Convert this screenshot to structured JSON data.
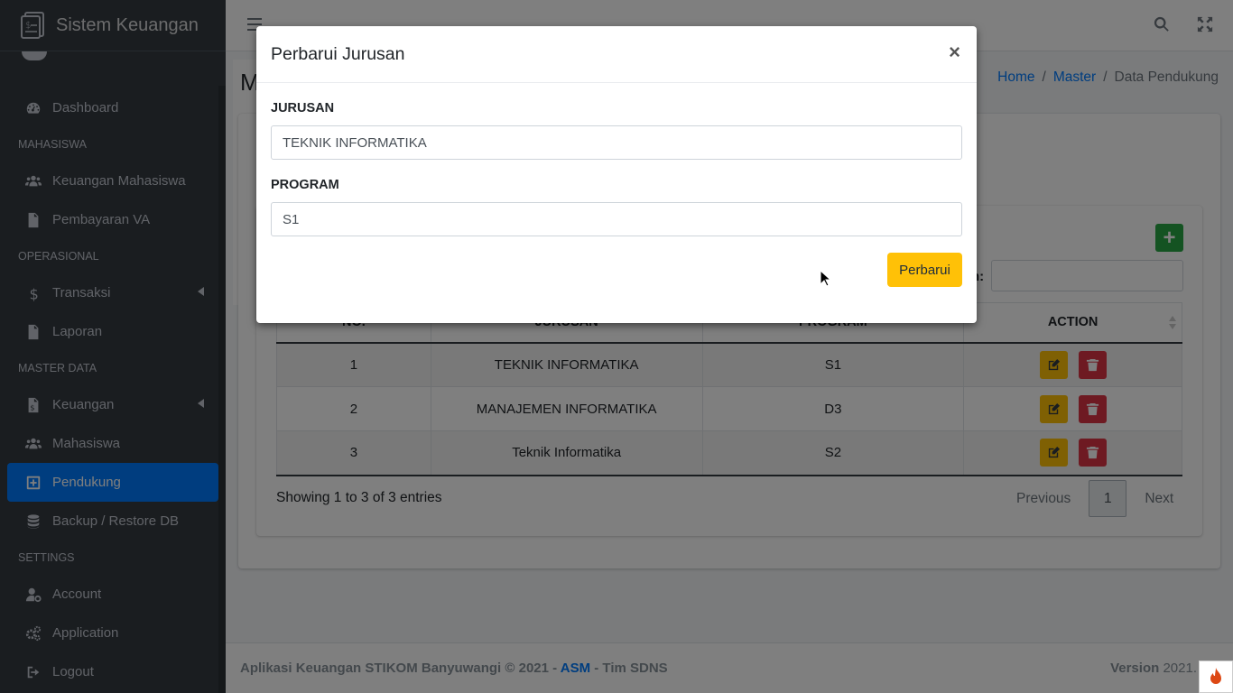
{
  "app": {
    "brand": "Sistem Keuangan"
  },
  "sidebar": {
    "items": [
      {
        "label": "Dashboard",
        "icon": "dashboard-icon"
      },
      {
        "header": "MAHASISWA"
      },
      {
        "label": "Keuangan Mahasiswa",
        "icon": "users-icon"
      },
      {
        "label": "Pembayaran VA",
        "icon": "file-icon"
      },
      {
        "header": "OPERASIONAL"
      },
      {
        "label": "Transaksi",
        "icon": "dollar-icon"
      },
      {
        "label": "Laporan",
        "icon": "file-icon"
      },
      {
        "header": "MASTER DATA"
      },
      {
        "label": "Keuangan",
        "icon": "invoice-icon"
      },
      {
        "label": "Mahasiswa",
        "icon": "users-icon"
      },
      {
        "label": "Pendukung",
        "icon": "plus-square-icon",
        "active": true
      },
      {
        "label": "Backup / Restore DB",
        "icon": "database-icon"
      },
      {
        "header": "SETTINGS"
      },
      {
        "label": "Account",
        "icon": "user-cog-icon"
      },
      {
        "label": "Application",
        "icon": "gears-icon"
      },
      {
        "label": "Logout",
        "icon": "logout-icon"
      }
    ]
  },
  "content": {
    "title": "M",
    "breadcrumb": {
      "home": "Home",
      "master": "Master",
      "current": "Data Pendukung"
    },
    "search_label": "h:",
    "table": {
      "headers": [
        "NO.",
        "JURUSAN",
        "PROGRAM",
        "ACTION"
      ],
      "rows": [
        {
          "no": "1",
          "jurusan": "TEKNIK INFORMATIKA",
          "program": "S1"
        },
        {
          "no": "2",
          "jurusan": "MANAJEMEN INFORMATIKA",
          "program": "D3"
        },
        {
          "no": "3",
          "jurusan": "Teknik Informatika",
          "program": "S2"
        }
      ]
    },
    "info": "Showing 1 to 3 of 3 entries",
    "pager": {
      "previous": "Previous",
      "current": "1",
      "next": "Next"
    }
  },
  "footer": {
    "left_prefix": "Aplikasi Keuangan STIKOM Banyuwangi © 2021 - ",
    "left_link": "ASM",
    "left_suffix": " - Tim SDNS",
    "version_label": "Version",
    "version_value": "2021."
  },
  "modal": {
    "title": "Perbarui Jurusan",
    "close": "×",
    "jurusan_label": "JURUSAN",
    "jurusan_value": "TEKNIK INFORMATIKA",
    "program_label": "PROGRAM",
    "program_value": "S1",
    "submit": "Perbarui"
  },
  "colors": {
    "sidebar_bg": "#343a40",
    "active": "#007bff",
    "warning": "#ffc107",
    "danger": "#dc3545",
    "success": "#28a745"
  }
}
